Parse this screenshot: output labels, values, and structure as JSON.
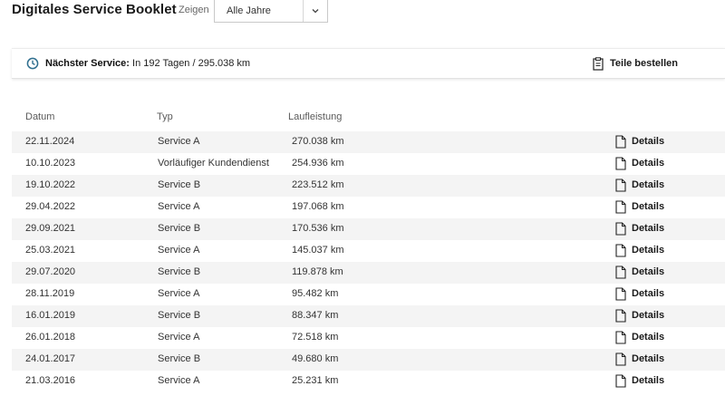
{
  "header": {
    "title": "Digitales Service Booklet",
    "show_label": "Zeigen",
    "year_select": {
      "value": "Alle Jahre",
      "icon": "chevron-down-icon"
    }
  },
  "next_service": {
    "label": "Nächster Service:",
    "value": "In 192 Tagen / 295.038 km",
    "icon": "clock-icon",
    "accent_color": "#2f6f8f",
    "parts_button": {
      "label": "Teile bestellen",
      "icon": "clipboard-icon"
    }
  },
  "table": {
    "columns": [
      "Datum",
      "Typ",
      "Laufleistung"
    ],
    "details_label": "Details",
    "rows": [
      {
        "date": "22.11.2024",
        "type": "Service A",
        "km": "270.038 km"
      },
      {
        "date": "10.10.2023",
        "type": "Vorläufiger Kundendienst",
        "km": "254.936 km"
      },
      {
        "date": "19.10.2022",
        "type": "Service B",
        "km": "223.512 km"
      },
      {
        "date": "29.04.2022",
        "type": "Service A",
        "km": "197.068 km"
      },
      {
        "date": "29.09.2021",
        "type": "Service B",
        "km": "170.536 km"
      },
      {
        "date": "25.03.2021",
        "type": "Service A",
        "km": "145.037 km"
      },
      {
        "date": "29.07.2020",
        "type": "Service B",
        "km": "119.878 km"
      },
      {
        "date": "28.11.2019",
        "type": "Service A",
        "km": "95.482 km"
      },
      {
        "date": "16.01.2019",
        "type": "Service B",
        "km": "88.347 km"
      },
      {
        "date": "26.01.2018",
        "type": "Service A",
        "km": "72.518 km"
      },
      {
        "date": "24.01.2017",
        "type": "Service B",
        "km": "49.680 km"
      },
      {
        "date": "21.03.2016",
        "type": "Service A",
        "km": "25.231 km"
      }
    ]
  }
}
